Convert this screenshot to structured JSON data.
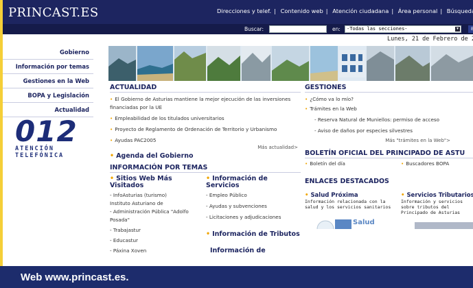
{
  "header": {
    "logo": "PRINCAST.ES",
    "links": [
      "Direcciones y telef.",
      "Contenido web",
      "Atención ciudadana",
      "Área personal",
      "Búsqueda Avanz"
    ],
    "search_label": "Buscar:",
    "search_value": "",
    "en_label": "en:",
    "section_select": "-Todas las secciones-",
    "go_button": "B"
  },
  "date": "Lunes, 21 de Febrero de 200",
  "nav": {
    "items": [
      "Gobierno",
      "Información por temas",
      "Gestiones en la Web",
      "BOPA y Legislación",
      "Actualidad"
    ]
  },
  "badge": {
    "number": "012",
    "line1": "ATENCIÓN",
    "line2": "TELEFÓNICA"
  },
  "actualidad": {
    "title": "ACTUALIDAD",
    "news": [
      "El Gobierno de Asturias mantiene la mejor ejecución de las inversiones financiadas por la UE",
      "Empleabilidad de los titulados universitarios",
      "Proyecto de Reglamento de Ordenación de Territorio y Urbanismo",
      "Ayudas PAC2005"
    ],
    "more": "Más actualidad>",
    "agenda": "Agenda del Gobierno"
  },
  "gestiones": {
    "title": "GESTIONES",
    "items": [
      "¿Cómo va lo mío?",
      "Trámites en la Web"
    ],
    "sub_items": [
      "- Reserva Natural de Muniellos: permiso de acceso",
      "- Aviso de daños por especies silvestres"
    ],
    "more": "Más \"trámites en la Web\">"
  },
  "info_temas": {
    "title": "INFORMACIÓN POR TEMAS",
    "sitios_title": "Sitios Web Más Visitados",
    "sitios": [
      "- InfoAsturias (turismo)",
      "Instituto Asturiano de",
      "- Administración Pública \"Adolfo",
      "Posada\"",
      "- Trabajastur",
      "- Educastur",
      "- Páxina Xoven"
    ],
    "servicios_title": "Información de Servicios",
    "servicios": [
      "- Empleo Público",
      "- Ayudas y subvenciones",
      "- Licitaciones y adjudicaciones"
    ],
    "tributos_title": "Información de Tributos",
    "more_title": "Información de"
  },
  "bopa": {
    "title": "BOLETÍN OFICIAL DEL PRINCIPADO DE ASTU",
    "items": [
      "Boletín del día",
      "Buscadores BOPA"
    ]
  },
  "enlaces": {
    "title": "ENLACES DESTACADOS",
    "salud_title": "Salud Próxima",
    "salud_desc": "Información relacionada con la salud y los servicios sanitarios",
    "serv_title": "Servicios Tributarios",
    "serv_desc": "Información y servicios sobre tributos del Principado de Asturias",
    "salud_logo": "Salud"
  },
  "caption": "Web www.princast.es.",
  "colors": {
    "header": "#1d2560",
    "frame": "#f5cf38",
    "accent": "#f0a500",
    "caption_bar": "#1d2c6c"
  }
}
